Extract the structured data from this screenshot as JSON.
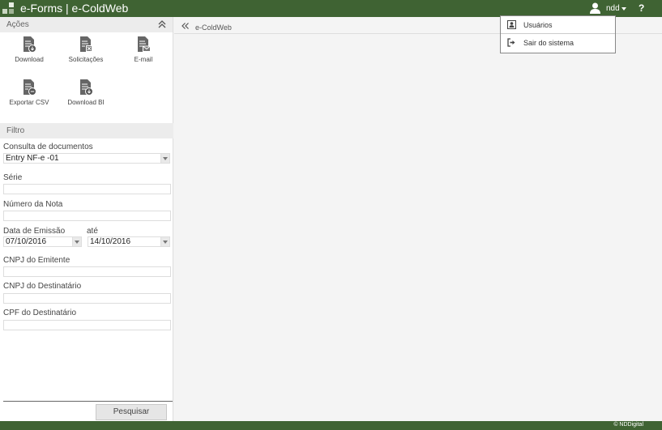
{
  "header": {
    "title": "e-Forms | e-ColdWeb",
    "user": "ndd",
    "help": "?"
  },
  "actions": {
    "title": "Ações",
    "items": [
      {
        "label": "Download",
        "icon": "download-document-icon"
      },
      {
        "label": "Solicitações",
        "icon": "requests-document-icon"
      },
      {
        "label": "E-mail",
        "icon": "email-document-icon"
      },
      {
        "label": "Exportar CSV",
        "icon": "export-csv-document-icon"
      },
      {
        "label": "Download BI",
        "icon": "download-bi-document-icon"
      }
    ]
  },
  "filter": {
    "title": "Filtro",
    "consulta_label": "Consulta de documentos",
    "consulta_value": "Entry NF-e -01",
    "serie_label": "Série",
    "serie_value": "",
    "numero_label": "Número da Nota",
    "numero_value": "",
    "emissao_label": "Data de Emissão",
    "emissao_from": "07/10/2016",
    "ate_label": "até",
    "emissao_to": "14/10/2016",
    "cnpj_emit_label": "CNPJ do Emitente",
    "cnpj_emit_value": "",
    "cnpj_dest_label": "CNPJ do Destinatário",
    "cnpj_dest_value": "",
    "cpf_dest_label": "CPF do Destinatário",
    "cpf_dest_value": "",
    "search_button": "Pesquisar"
  },
  "main": {
    "breadcrumb": "e-ColdWeb"
  },
  "user_menu": {
    "items": [
      {
        "label": "Usuários",
        "icon": "users-icon"
      },
      {
        "label": "Sair do sistema",
        "icon": "sign-out-icon"
      }
    ]
  },
  "footer": {
    "copyright": "© NDDigital"
  },
  "colors": {
    "brand_green": "#3f6333",
    "panel_header": "#ececec"
  }
}
